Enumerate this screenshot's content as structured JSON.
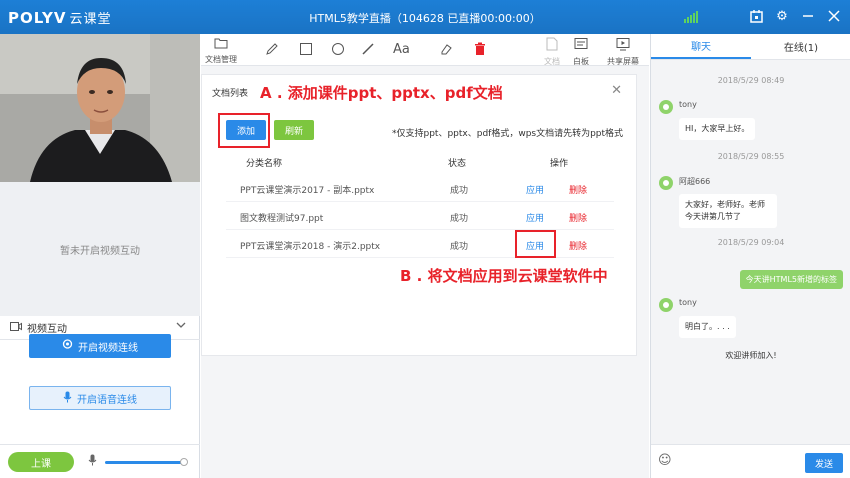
{
  "titlebar": {
    "logo": "POLYV",
    "logo_sub": "云课堂",
    "title": "HTML5教学直播（104628 已直播00:00:00）",
    "icons": [
      "signal-icon",
      "calendar-icon",
      "gear-icon",
      "minimize-icon",
      "close-icon"
    ]
  },
  "left": {
    "no_video_text": "暂未开启视频互动",
    "video_interaction_label": "视频互动",
    "start_video_label": "开启视频连线",
    "start_voice_label": "开启语音连线",
    "class_button_label": "上课",
    "volume": 0.95
  },
  "toolbar": {
    "items": [
      {
        "label": "文档管理",
        "icon": "folder-icon"
      },
      {
        "label": "",
        "icon": "pencil-icon"
      },
      {
        "label": "",
        "icon": "rectangle-icon"
      },
      {
        "label": "",
        "icon": "circle-icon"
      },
      {
        "label": "",
        "icon": "line-icon"
      },
      {
        "label": "Aa",
        "icon": "text-icon"
      },
      {
        "label": "",
        "icon": "eraser-icon"
      },
      {
        "label": "",
        "icon": "trash-icon"
      },
      {
        "label": "文档",
        "icon": "document-icon"
      },
      {
        "label": "白板",
        "icon": "whiteboard-icon"
      },
      {
        "label": "共享屏幕",
        "icon": "share-screen-icon"
      }
    ]
  },
  "doc_panel": {
    "title": "文档列表",
    "annotation_a": "A . 添加课件ppt、pptx、pdf文档",
    "annotation_b": "B . 将文档应用到云课堂软件中",
    "add_label": "添加",
    "refresh_label": "刷新",
    "notice": "*仅支持ppt、pptx、pdf格式，wps文档请先转为ppt格式",
    "columns": [
      "分类名称",
      "状态",
      "操作"
    ],
    "rows": [
      {
        "name": "PPT云课堂演示2017 - 副本.pptx",
        "status": "成功",
        "apply": "应用",
        "delete": "删除"
      },
      {
        "name": "图文教程测试97.ppt",
        "status": "成功",
        "apply": "应用",
        "delete": "删除"
      },
      {
        "name": "PPT云课堂演示2018 - 演示2.pptx",
        "status": "成功",
        "apply": "应用",
        "delete": "删除"
      }
    ]
  },
  "chat": {
    "tabs": [
      "聊天",
      "在线(1)"
    ],
    "messages": [
      {
        "time": "2018/5/29 08:49",
        "user": "tony",
        "text": "HI，大家早上好。"
      },
      {
        "time": "2018/5/29 08:55",
        "user": "阿超666",
        "text": "大家好，老师好。老师今天讲第几节了"
      },
      {
        "time": "2018/5/29 09:04",
        "user": "",
        "text": "今天讲HTML5新增的标签"
      },
      {
        "time": "",
        "user": "tony",
        "text": "明白了。. . ."
      }
    ],
    "welcome": "欢迎讲师加入!",
    "send_label": "发送"
  },
  "colors": {
    "accent": "#2a8ae8",
    "green": "#7dc63f",
    "annotation": "#e8222a",
    "title_bar": "#1d7fd6"
  }
}
